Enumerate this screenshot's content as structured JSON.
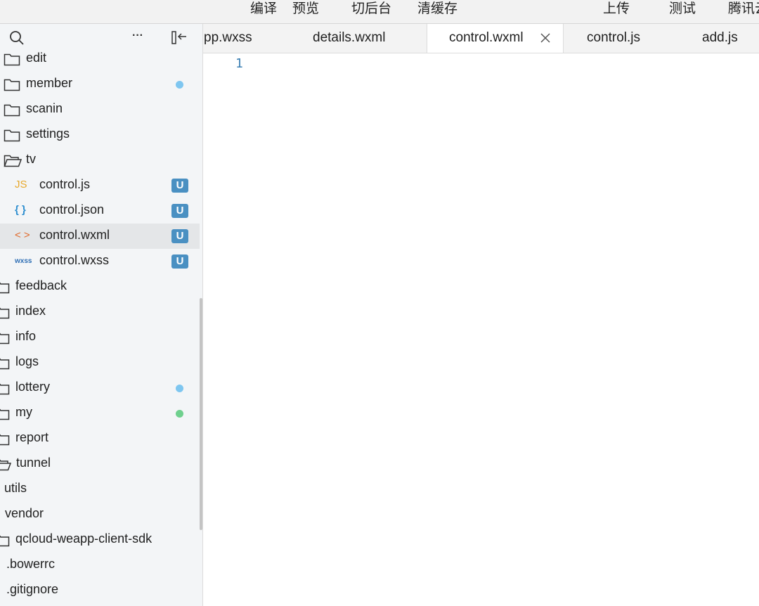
{
  "toolbar": {
    "compile": "编译",
    "preview": "预览",
    "background": "切后台",
    "clear_cache": "清缓存",
    "upload": "上传",
    "test": "测试",
    "tencent_cloud": "腾讯云"
  },
  "sidebar": {
    "icons": {
      "search": "search-icon",
      "more": "more-icon",
      "collapse": "collapse-sidebar-icon"
    },
    "more_label": "···",
    "tree": [
      {
        "label": "edit",
        "kind": "folder"
      },
      {
        "label": "member",
        "kind": "folder",
        "status": "dot",
        "dot_color": "#7ec6f0"
      },
      {
        "label": "scanin",
        "kind": "folder"
      },
      {
        "label": "settings",
        "kind": "folder"
      },
      {
        "label": "tv",
        "kind": "folder-open"
      },
      {
        "label": "control.js",
        "kind": "file",
        "type_label": "JS",
        "type_color": "#e8a92c",
        "status": "U"
      },
      {
        "label": "control.json",
        "kind": "file",
        "type_label": "{ }",
        "type_color": "#2f8fd0",
        "status": "U"
      },
      {
        "label": "control.wxml",
        "kind": "file",
        "type_label": "< >",
        "type_color": "#e06a2c",
        "status": "U",
        "selected": true
      },
      {
        "label": "control.wxss",
        "kind": "file",
        "type_label": "wxss",
        "type_color": "#2f6fb5",
        "status": "U"
      },
      {
        "label": "feedback",
        "kind": "folder"
      },
      {
        "label": "index",
        "kind": "folder"
      },
      {
        "label": "info",
        "kind": "folder"
      },
      {
        "label": "logs",
        "kind": "folder"
      },
      {
        "label": "lottery",
        "kind": "folder",
        "status": "dot",
        "dot_color": "#7ec6f0"
      },
      {
        "label": "my",
        "kind": "folder",
        "status": "dot",
        "dot_color": "#6fd08e"
      },
      {
        "label": "report",
        "kind": "folder"
      },
      {
        "label": "tunnel",
        "kind": "folder-open"
      },
      {
        "label": "utils",
        "kind": "plain"
      },
      {
        "label": "vendor",
        "kind": "plain"
      },
      {
        "label": "qcloud-weapp-client-sdk",
        "kind": "folder"
      },
      {
        "label": ".bowerrc",
        "kind": "plain"
      },
      {
        "label": ".gitignore",
        "kind": "plain"
      }
    ]
  },
  "tabs": [
    {
      "label": "pp.wxss"
    },
    {
      "label": "details.wxml"
    },
    {
      "label": "control.wxml",
      "active": true
    },
    {
      "label": "control.js"
    },
    {
      "label": "add.js"
    }
  ],
  "editor": {
    "line_numbers": [
      "1"
    ]
  }
}
